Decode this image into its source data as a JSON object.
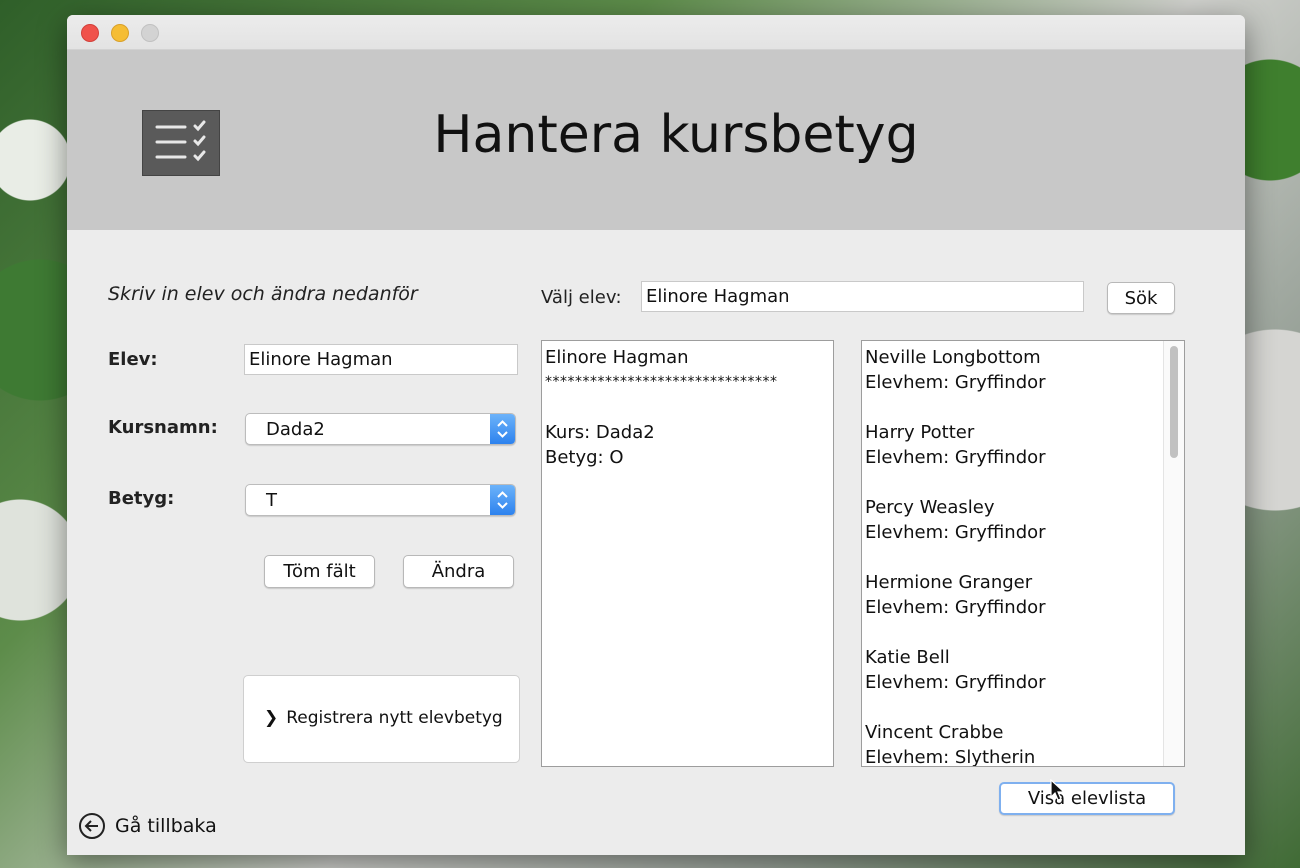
{
  "window": {
    "title": "Hantera kursbetyg"
  },
  "form": {
    "instruction": "Skriv in elev och ändra nedanför",
    "elev_label": "Elev:",
    "elev_value": "Elinore Hagman",
    "kursnamn_label": "Kursnamn:",
    "kursnamn_value": "Dada2",
    "betyg_label": "Betyg:",
    "betyg_value": "T",
    "clear_button": "Töm fält",
    "change_button": "Ändra",
    "register_link": "Registrera nytt elevbetyg"
  },
  "search": {
    "label": "Välj elev:",
    "value": "Elinore Hagman",
    "button": "Sök"
  },
  "result": {
    "lines": [
      "Elinore Hagman",
      "*******************************",
      "",
      "Kurs: Dada2",
      "Betyg: O"
    ]
  },
  "student_list": {
    "lines": [
      "Neville Longbottom",
      "Elevhem: Gryffindor",
      "",
      "Harry Potter",
      "Elevhem: Gryffindor",
      "",
      "Percy Weasley",
      "Elevhem: Gryffindor",
      "",
      "Hermione Granger",
      "Elevhem: Gryffindor",
      "",
      "Katie Bell",
      "Elevhem: Gryffindor",
      "",
      "Vincent Crabbe",
      "Elevhem: Slytherin"
    ],
    "show_button": "Visa elevlista"
  },
  "footer": {
    "back_label": "Gå tillbaka"
  },
  "colors": {
    "header_bg": "#c8c8c8",
    "window_bg": "#ececec",
    "select_accent": "#3b8ff3"
  },
  "icons": {
    "header": "checklist-icon",
    "register": "chevron-right-icon",
    "back": "arrow-left-circle-icon",
    "select": "updown-chevron-icon"
  }
}
